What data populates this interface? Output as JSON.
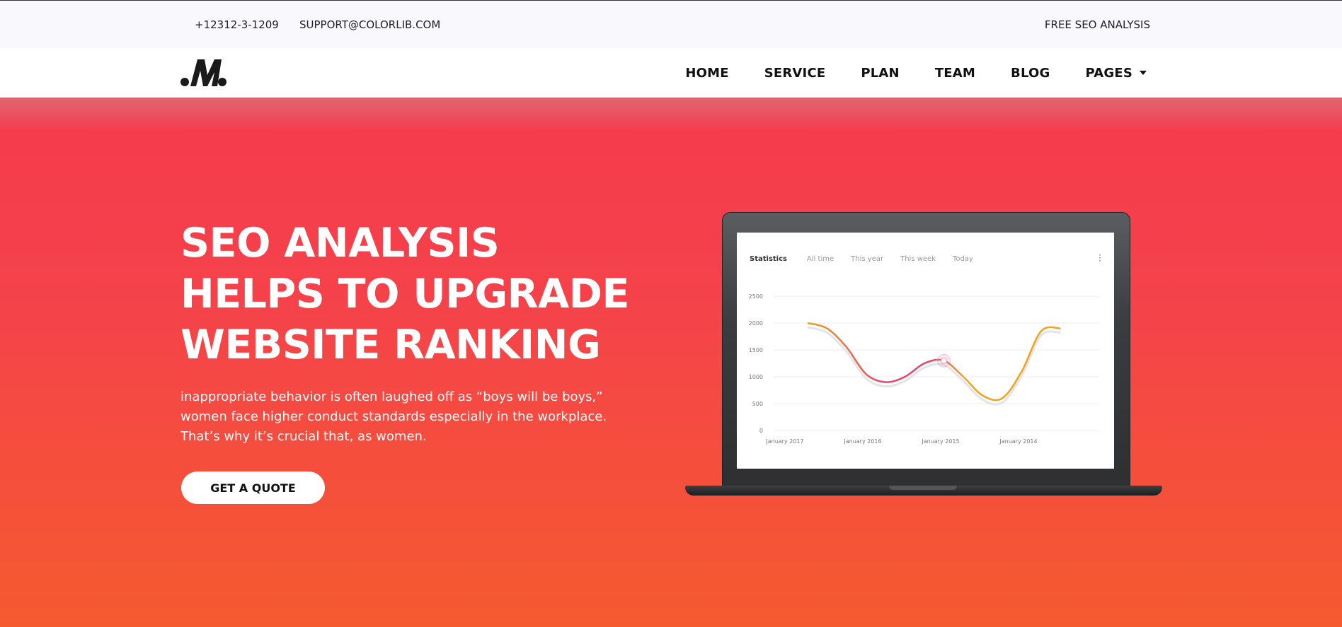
{
  "topbar": {
    "phone": "+12312-3-1209",
    "email": "SUPPORT@COLORLIB.COM",
    "free_seo": "FREE SEO ANALYSIS"
  },
  "nav": {
    "items": [
      "HOME",
      "SERVICE",
      "PLAN",
      "TEAM",
      "BLOG",
      "PAGES"
    ]
  },
  "hero": {
    "title_lines": [
      "SEO ANALYSIS",
      "HELPS TO UPGRADE",
      "WEBSITE RANKING"
    ],
    "description": "inappropriate behavior is often laughed off as “boys will be boys,” women face higher conduct standards especially in the workplace. That’s why it’s crucial that, as women.",
    "cta": "GET A QUOTE"
  },
  "stats": {
    "title": "Statistics",
    "tabs": [
      "All time",
      "This year",
      "This week",
      "Today"
    ]
  },
  "colors": {
    "hero_top": "#f53a4e",
    "hero_bottom": "#f55a2f",
    "line_orange": "#f0a31d",
    "line_pink": "#e8436b"
  },
  "chart_data": {
    "type": "line",
    "categories": [
      "January 2017",
      "January 2016",
      "January 2015",
      "January 2014"
    ],
    "yticks": [
      2500,
      2000,
      1500,
      1000,
      500,
      0
    ],
    "ylim": [
      0,
      2500
    ],
    "series": [
      {
        "x": [
          0,
          0.25,
          0.5,
          0.75,
          1.0,
          1.25,
          1.5,
          1.75,
          2.0,
          2.25,
          2.5,
          2.75,
          3.0,
          3.25
        ],
        "values": [
          2000,
          1900,
          1550,
          1050,
          900,
          1000,
          1250,
          1300,
          1000,
          650,
          600,
          1100,
          1850,
          1900
        ]
      }
    ]
  }
}
